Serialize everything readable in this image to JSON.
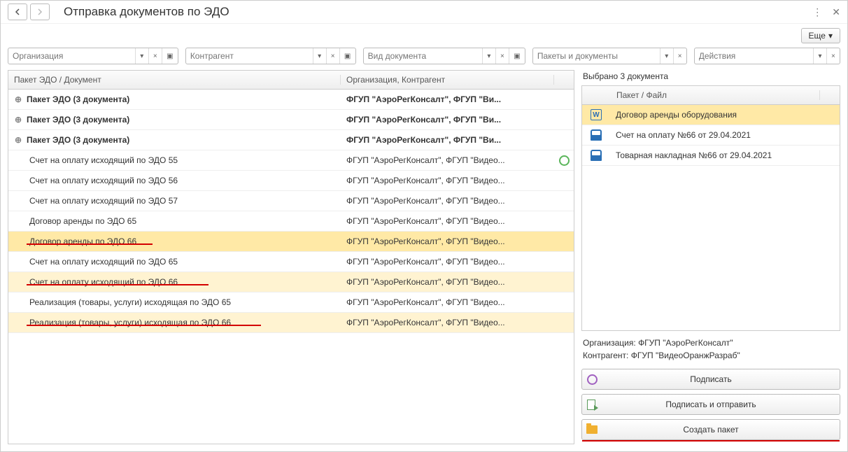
{
  "title": "Отправка документов по ЭДО",
  "more_button": "Еще",
  "filters": {
    "org": "Организация",
    "contractor": "Контрагент",
    "doctype": "Вид документа",
    "packages": "Пакеты и документы",
    "actions": "Действия"
  },
  "table": {
    "col1": "Пакет ЭДО / Документ",
    "col2": "Организация, Контрагент"
  },
  "rows": [
    {
      "text": "Пакет ЭДО (3 документа)",
      "org": "ФГУП \"АэроРегКонсалт\", ФГУП \"Ви...",
      "bold": true,
      "exp": true
    },
    {
      "text": "Пакет ЭДО (3 документа)",
      "org": "ФГУП \"АэроРегКонсалт\", ФГУП \"Ви...",
      "bold": true,
      "exp": true
    },
    {
      "text": "Пакет ЭДО (3 документа)",
      "org": "ФГУП \"АэроРегКонсалт\", ФГУП \"Ви...",
      "bold": true,
      "exp": true
    },
    {
      "text": "Счет на оплату исходящий по ЭДО 55",
      "org": "ФГУП \"АэроРегКонсалт\", ФГУП \"Видео...",
      "status": true
    },
    {
      "text": "Счет на оплату исходящий по ЭДО 56",
      "org": "ФГУП \"АэроРегКонсалт\", ФГУП \"Видео..."
    },
    {
      "text": "Счет на оплату исходящий по ЭДО 57",
      "org": "ФГУП \"АэроРегКонсалт\", ФГУП \"Видео..."
    },
    {
      "text": "Договор аренды по ЭДО 65",
      "org": "ФГУП \"АэроРегКонсалт\", ФГУП \"Видео..."
    },
    {
      "text": "Договор аренды по ЭДО 66",
      "org": "ФГУП \"АэроРегКонсалт\", ФГУП \"Видео...",
      "sel": "sel",
      "ul": "ul-1"
    },
    {
      "text": "Счет на оплату исходящий по ЭДО 65",
      "org": "ФГУП \"АэроРегКонсалт\", ФГУП \"Видео..."
    },
    {
      "text": "Счет на оплату исходящий по ЭДО 66",
      "org": "ФГУП \"АэроРегКонсалт\", ФГУП \"Видео...",
      "sel": "sel2",
      "ul": "ul-2"
    },
    {
      "text": "Реализация (товары, услуги) исходящая по ЭДО 65",
      "org": "ФГУП \"АэроРегКонсалт\", ФГУП \"Видео..."
    },
    {
      "text": "Реализация (товары, услуги) исходящая по ЭДО 66",
      "org": "ФГУП \"АэроРегКонсалт\", ФГУП \"Видео...",
      "sel": "sel2",
      "ul": "ul-3"
    }
  ],
  "selected_label": "Выбрано 3 документа",
  "files_header": "Пакет / Файл",
  "files": [
    {
      "name": "Договор аренды оборудования",
      "icon": "w",
      "selected": true
    },
    {
      "name": "Счет на оплату №66 от 29.04.2021",
      "icon": "s"
    },
    {
      "name": "Товарная накладная №66 от 29.04.2021",
      "icon": "s"
    }
  ],
  "info_org_label": "Организация:",
  "info_org_value": "ФГУП \"АэроРегКонсалт\"",
  "info_ctr_label": "Контрагент:",
  "info_ctr_value": "ФГУП \"ВидеоОранжРазраб\"",
  "btn_sign": "Подписать",
  "btn_sign_send": "Подписать и отправить",
  "btn_create": "Создать пакет"
}
